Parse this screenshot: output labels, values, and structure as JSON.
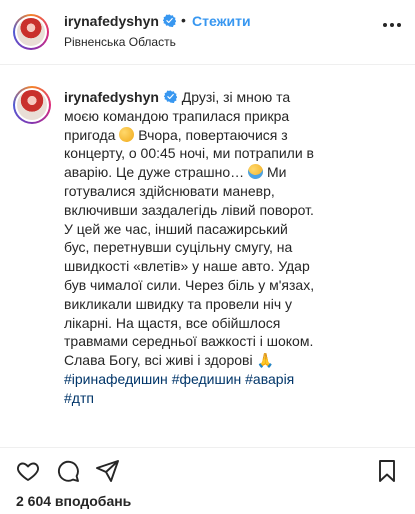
{
  "header": {
    "username": "irynafedyshyn",
    "dot": "•",
    "follow_label": "Стежити",
    "location": "Рівненська Область"
  },
  "caption": {
    "username": "irynafedyshyn",
    "part1": " Друзі, зі мною та моєю командою трапилася прикра пригода ",
    "part2": " Вчора, повертаючися з концерту, о 00:45 ночі, ми потрапили в аварію. Це дуже страшно… ",
    "part3": " Ми готувалися здійснювати маневр, включивши заздалегідь лівий поворот. У цей же час, інший пасажирський бус, перетнувши суцільну смугу, на швидкості «влетів» у наше авто. Удар був чималої сили. Через біль у м'язах, викликали швидку та провели ніч у лікарні. На щастя, все обійшлося травмами середньої важкості і шоком. Слава Богу, всі живі і здорові",
    "pray_emoji": "🙏",
    "hashtags": [
      "#іринафедишин",
      "#федишин",
      "#аварія",
      "#дтп"
    ]
  },
  "actions": {
    "likes": "2 604 вподобань"
  },
  "colors": {
    "link": "#3897f0",
    "hashtag": "#003569",
    "text": "#262626"
  },
  "icons": [
    "verified-badge-icon",
    "more-options-icon",
    "heart-icon",
    "comment-icon",
    "share-icon",
    "bookmark-icon"
  ]
}
